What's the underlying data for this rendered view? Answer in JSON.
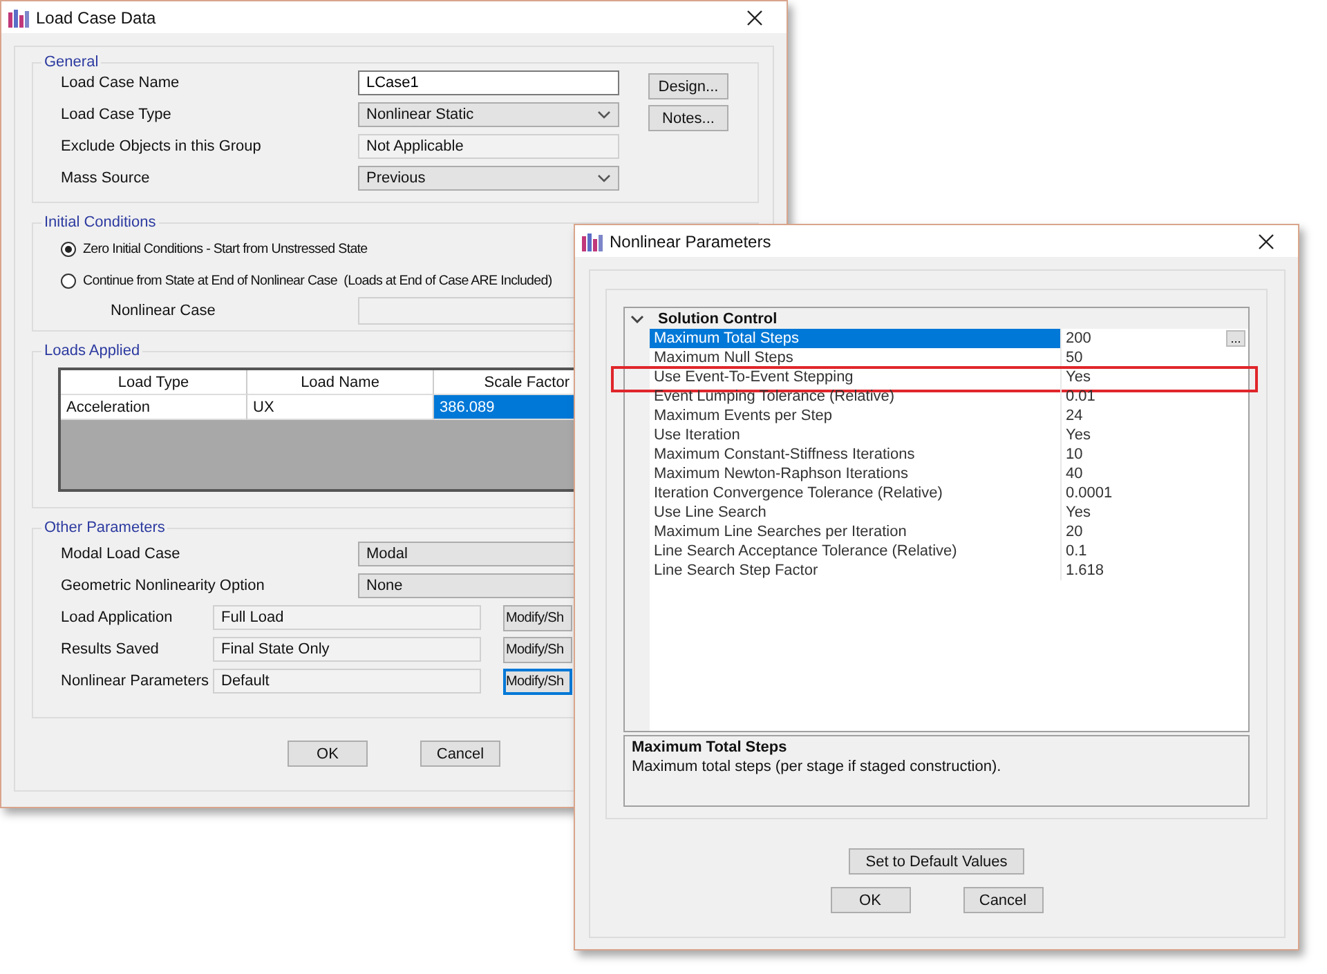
{
  "load_case_window": {
    "title": "Load Case Data",
    "general": {
      "title": "General",
      "fields": [
        {
          "label": "Load Case Name",
          "value": "LCase1",
          "kind": "text"
        },
        {
          "label": "Load Case Type",
          "value": "Nonlinear Static",
          "kind": "dropdown"
        },
        {
          "label": "Exclude Objects in this Group",
          "value": "Not Applicable",
          "kind": "readonly"
        },
        {
          "label": "Mass Source",
          "value": "Previous",
          "kind": "dropdown"
        }
      ],
      "buttons": [
        "Design...",
        "Notes..."
      ]
    },
    "initial_conditions": {
      "title": "Initial Conditions",
      "options": [
        {
          "label": "Zero Initial Conditions - Start from Unstressed State",
          "selected": true
        },
        {
          "label": "Continue from State at End of Nonlinear Case  (Loads at End of Case ARE Included)",
          "selected": false
        }
      ],
      "nonlinear_case_label": "Nonlinear Case"
    },
    "loads_applied": {
      "title": "Loads Applied",
      "columns": [
        "Load Type",
        "Load Name",
        "Scale Factor"
      ],
      "rows": [
        {
          "cells": [
            {
              "text": "Acceleration",
              "selected": false
            },
            {
              "text": "UX",
              "selected": false
            },
            {
              "text": "386.089",
              "selected": true
            }
          ]
        }
      ]
    },
    "other_parameters": {
      "title": "Other Parameters",
      "dropdowns": [
        {
          "label": "Modal Load Case",
          "value": "Modal"
        },
        {
          "label": "Geometric Nonlinearity Option",
          "value": "None"
        }
      ],
      "settings": [
        {
          "label": "Load Application",
          "value": "Full Load",
          "button": "Modify/Sh",
          "focused": false
        },
        {
          "label": "Results Saved",
          "value": "Final State Only",
          "button": "Modify/Sh",
          "focused": false
        },
        {
          "label": "Nonlinear Parameters",
          "value": "Default",
          "button": "Modify/Sh",
          "focused": true
        }
      ]
    },
    "buttons": [
      "OK",
      "Cancel"
    ]
  },
  "nonlinear_window": {
    "title": "Nonlinear Parameters",
    "category": {
      "label": "Solution Control",
      "expanded": true,
      "properties": [
        {
          "name": "Maximum Total Steps",
          "value": "200",
          "selected": true,
          "highlighted": false,
          "action": "..."
        },
        {
          "name": "Maximum Null Steps",
          "value": "50",
          "selected": false,
          "highlighted": false
        },
        {
          "name": "Use Event-To-Event Stepping",
          "value": "Yes",
          "selected": false,
          "highlighted": true
        },
        {
          "name": "Event Lumping Tolerance (Relative)",
          "value": "0.01",
          "selected": false,
          "highlighted": false
        },
        {
          "name": "Maximum Events per Step",
          "value": "24",
          "selected": false,
          "highlighted": false
        },
        {
          "name": "Use Iteration",
          "value": "Yes",
          "selected": false,
          "highlighted": false
        },
        {
          "name": "Maximum Constant-Stiffness Iterations",
          "value": "10",
          "selected": false,
          "highlighted": false
        },
        {
          "name": "Maximum Newton-Raphson Iterations",
          "value": "40",
          "selected": false,
          "highlighted": false
        },
        {
          "name": "Iteration Convergence Tolerance (Relative)",
          "value": "0.0001",
          "selected": false,
          "highlighted": false
        },
        {
          "name": "Use Line Search",
          "value": "Yes",
          "selected": false,
          "highlighted": false
        },
        {
          "name": "Maximum Line Searches per Iteration",
          "value": "20",
          "selected": false,
          "highlighted": false
        },
        {
          "name": "Line Search Acceptance Tolerance (Relative)",
          "value": "0.1",
          "selected": false,
          "highlighted": false
        },
        {
          "name": "Line Search Step Factor",
          "value": "1.618",
          "selected": false,
          "highlighted": false
        }
      ]
    },
    "description": {
      "title": "Maximum Total Steps",
      "text": "Maximum total steps (per stage if staged construction)."
    },
    "default_button": "Set to Default Values",
    "buttons": [
      "OK",
      "Cancel"
    ]
  }
}
